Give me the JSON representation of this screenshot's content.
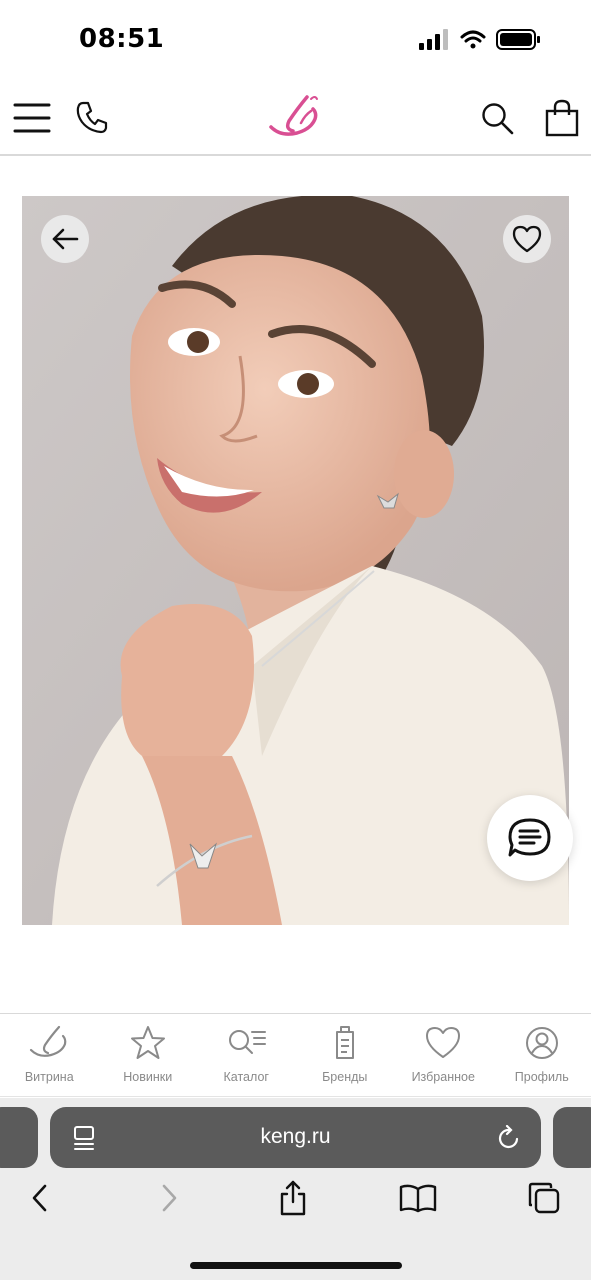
{
  "status_bar": {
    "time": "08:51",
    "icons": [
      "cellular-signal-icon",
      "wifi-icon",
      "battery-icon"
    ]
  },
  "header": {
    "icons": [
      "menu-icon",
      "phone-icon",
      "brand-logo",
      "search-icon",
      "cart-icon"
    ],
    "logo_color": "#d94f93"
  },
  "product": {
    "image": "photo of smiling girl wearing bow-shaped earrings, necklace and bracelet",
    "back_icon": "arrow-left-icon",
    "favorite_icon": "heart-icon",
    "chat_icon": "chat-icon"
  },
  "bottom_nav": {
    "items": [
      {
        "label": "Витрина",
        "icon": "showcase-logo-icon"
      },
      {
        "label": "Новинки",
        "icon": "star-icon"
      },
      {
        "label": "Каталог",
        "icon": "catalog-search-icon"
      },
      {
        "label": "Бренды",
        "icon": "tag-icon"
      },
      {
        "label": "Избранное",
        "icon": "heart-icon"
      },
      {
        "label": "Профиль",
        "icon": "profile-icon"
      }
    ]
  },
  "browser": {
    "url": "keng.ru",
    "toolbar": [
      "back-icon",
      "forward-icon",
      "share-icon",
      "bookmarks-icon",
      "tabs-icon"
    ]
  },
  "colors": {
    "accent_pink": "#d94f93",
    "nav_gray": "#8a8a8a",
    "url_bar": "#5b5b5b",
    "photo_bg": "#c7c2c1"
  }
}
